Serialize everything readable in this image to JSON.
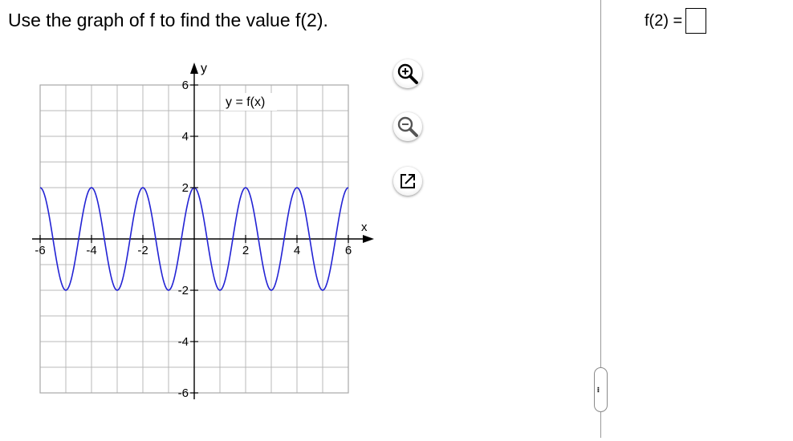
{
  "question": {
    "prompt": "Use the graph of f to find the value f(2)."
  },
  "answer": {
    "label": "f(2) =",
    "value": ""
  },
  "tools": [
    {
      "name": "zoom-in-icon"
    },
    {
      "name": "zoom-out-icon"
    },
    {
      "name": "popout-icon"
    }
  ],
  "more_button": {
    "label": "..."
  },
  "colors": {
    "curve": "#2323d4",
    "grid": "#b8b8b8",
    "axis": "#000000",
    "border": "#a8a8a8"
  },
  "chart_data": {
    "type": "line",
    "xlabel": "x",
    "ylabel": "y",
    "xlim": [
      -6,
      6
    ],
    "ylim": [
      -6,
      6
    ],
    "grid": true,
    "x_ticks": [
      -6,
      -4,
      -2,
      2,
      4,
      6
    ],
    "x_tick_labels": [
      "-6",
      "-4",
      "-2",
      "2",
      "4",
      "6"
    ],
    "y_ticks": [
      6,
      4,
      2,
      -2,
      -4,
      -6
    ],
    "y_tick_labels": [
      "6",
      "4",
      "2",
      "-2",
      "-4",
      "-6"
    ],
    "annotation": "y = f(x)",
    "series": [
      {
        "x": [
          -6,
          -5,
          -4,
          -3,
          -2,
          -1,
          0,
          1,
          2,
          3,
          4,
          5,
          6
        ],
        "y": [
          2,
          -2,
          2,
          -2,
          2,
          -2,
          2,
          -2,
          2,
          -2,
          2,
          -2,
          2
        ]
      }
    ]
  }
}
